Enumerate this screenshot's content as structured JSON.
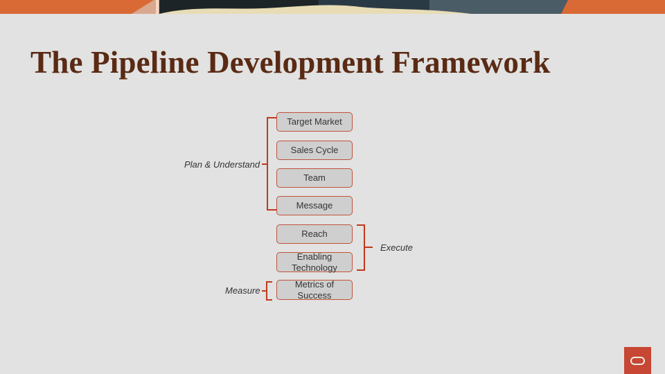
{
  "slide": {
    "title": "The Pipeline Development Framework",
    "colors": {
      "background": "#e1e2e1",
      "title": "#5a2a14",
      "bracket": "#c0391b",
      "box_fill": "#cfcfcf",
      "box_border": "#c0523b",
      "logo": "#c74634"
    }
  },
  "framework": {
    "steps": [
      {
        "label": "Target Market"
      },
      {
        "label": "Sales Cycle"
      },
      {
        "label": "Team"
      },
      {
        "label": "Message"
      },
      {
        "label": "Reach"
      },
      {
        "label": "Enabling Technology"
      },
      {
        "label": "Metrics of Success"
      }
    ],
    "groups": [
      {
        "label": "Plan & Understand",
        "covers": [
          "Target Market",
          "Sales Cycle",
          "Team",
          "Message"
        ]
      },
      {
        "label": "Execute",
        "covers": [
          "Reach",
          "Enabling Technology"
        ]
      },
      {
        "label": "Measure",
        "covers": [
          "Metrics of Success"
        ]
      }
    ]
  },
  "logo": {
    "icon": "oracle-logo-icon"
  }
}
